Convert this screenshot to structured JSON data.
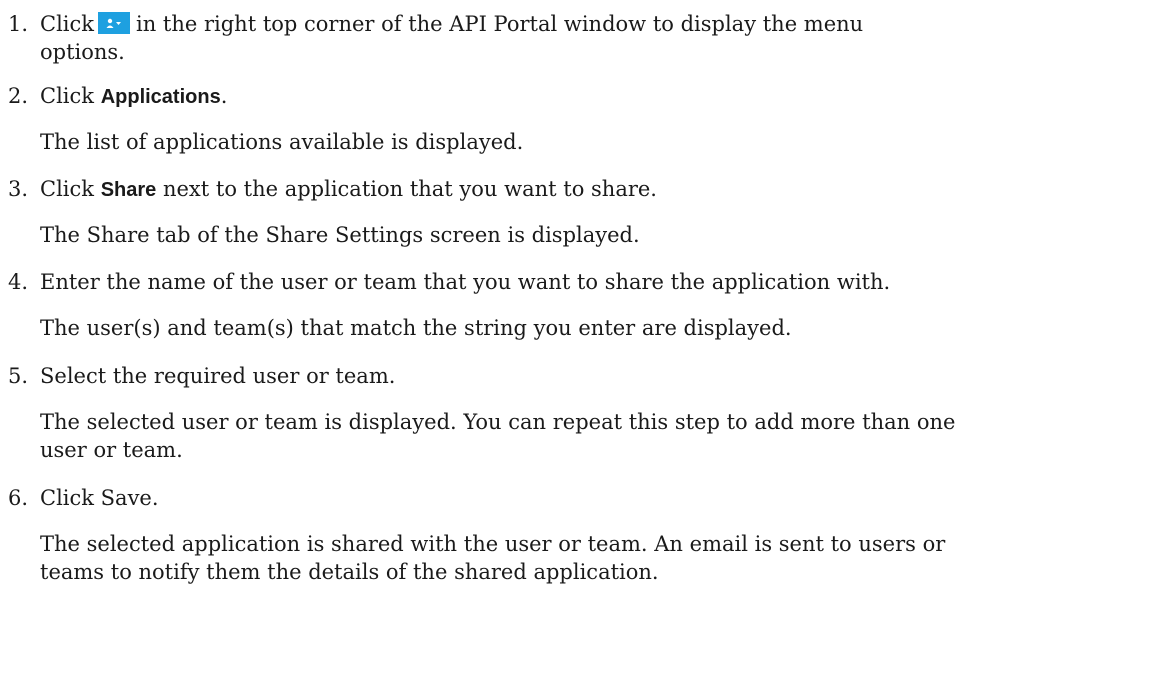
{
  "steps": [
    {
      "number": "1.",
      "text_before": "Click",
      "icon": "user-menu-icon",
      "text_after": "in the right top corner of the API Portal window to display the menu",
      "text_cont": "options."
    },
    {
      "number": "2.",
      "text_before": "Click",
      "bold": "Applications",
      "text_after": ".",
      "result": "The list of applications available is displayed."
    },
    {
      "number": "3.",
      "text_before": "Click",
      "bold": "Share",
      "text_after": "next to the application that you want to share.",
      "result": "The Share tab of the Share Settings screen is displayed."
    },
    {
      "number": "4.",
      "text": "Enter the name of the user or team that you want to share the application with.",
      "result": "The user(s) and team(s) that match the string you enter are displayed."
    },
    {
      "number": "5.",
      "text": "Select the required user or team.",
      "result_line1": "The selected user or team is displayed. You can repeat this step to add more than one",
      "result_line2": "user or team."
    },
    {
      "number": "6.",
      "text": "Click Save.",
      "result_line1": "The selected application is shared with the user or team. An email is sent to users or",
      "result_line2": "teams to notify them the details of the shared application."
    }
  ],
  "colors": {
    "icon_button": "#1ea0e0",
    "text": "#1a1a1a"
  }
}
